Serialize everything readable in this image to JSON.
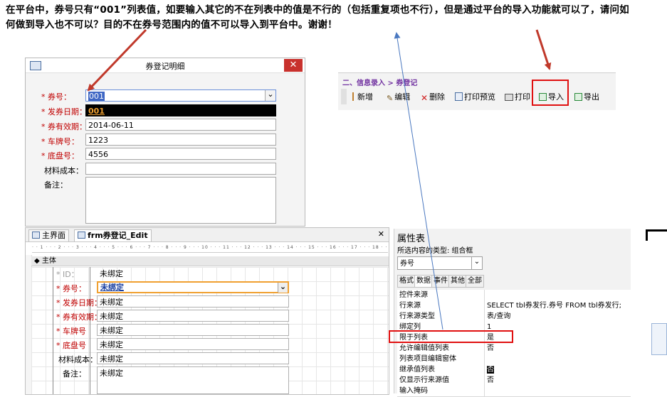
{
  "question": "在平台中，券号只有“001”列表值，如要输入其它的不在列表中的值是不行的（包括重复项也不行），但是通过平台的导入功能就可以了，请问如何做到导入也不可以？目的不在券号范围内的值不可以导入到平台中。谢谢！",
  "dialog": {
    "title": "券登记明细",
    "close": "✕",
    "fields": [
      {
        "label": "* 券号：",
        "value": "001"
      },
      {
        "label": "* 发券日期：",
        "value": "001"
      },
      {
        "label": "* 券有效期：",
        "value": "2014-06-11"
      },
      {
        "label": "* 车牌号：",
        "value": "1223"
      },
      {
        "label": "* 底盘号：",
        "value": "4556"
      },
      {
        "label": "材料成本：",
        "value": ""
      },
      {
        "label": "备注：",
        "value": ""
      }
    ],
    "dropdown_arrow": "⌄"
  },
  "toolbar": {
    "breadcrumb": "二、信息录入 > 券登记",
    "buttons": [
      {
        "label": "新增",
        "icon": "add-icon"
      },
      {
        "label": "编辑",
        "icon": "edit-icon"
      },
      {
        "label": "删除",
        "icon": "delete-icon"
      },
      {
        "label": "打印预览",
        "icon": "print-preview-icon"
      },
      {
        "label": "打印",
        "icon": "print-icon"
      },
      {
        "label": "导入",
        "icon": "import-icon"
      },
      {
        "label": "导出",
        "icon": "export-icon"
      }
    ]
  },
  "access": {
    "tabs": [
      "主界面",
      "frm券登记_Edit"
    ],
    "close_mark": "✕",
    "ruler": "· · 1 · · · 2 · · · 3 · · · 4 · · · 5 · · · 6 · · · 7 · · · 8 · · · 9 · · · 10 · · · 11 · · · 12 · · · 13 · · · 14 · · · 15 · · · 16 · · · 17 · · · 18 · ·",
    "section": "◆ 主体",
    "rows": [
      {
        "label": "* ID：",
        "value": "未绑定"
      },
      {
        "label": "* 券号：",
        "value": "未绑定"
      },
      {
        "label": "* 发券日期：",
        "value": "未绑定"
      },
      {
        "label": "* 券有效期：",
        "value": "未绑定"
      },
      {
        "label": "* 车牌号",
        "value": "未绑定"
      },
      {
        "label": "* 底盘号",
        "value": "未绑定"
      },
      {
        "label": "材料成本：",
        "value": "未绑定"
      },
      {
        "label": "备注：",
        "value": "未绑定"
      }
    ]
  },
  "props": {
    "title": "属性表",
    "type_label": "所选内容的类型: 组合框",
    "combo_value": "券号",
    "tabs": [
      "格式",
      "数据",
      "事件",
      "其他",
      "全部"
    ],
    "rows": [
      {
        "name": "控件来源",
        "value": ""
      },
      {
        "name": "行来源",
        "value": "SELECT tbl券发行.券号 FROM tbl券发行;"
      },
      {
        "name": "行来源类型",
        "value": "表/查询"
      },
      {
        "name": "绑定列",
        "value": "1"
      },
      {
        "name": "限于列表",
        "value": "是"
      },
      {
        "name": "允许编辑值列表",
        "value": "否"
      },
      {
        "name": "列表项目编辑窗体",
        "value": ""
      },
      {
        "name": "继承值列表",
        "value": "否"
      },
      {
        "name": "仅显示行来源值",
        "value": "否"
      },
      {
        "name": "输入掩码",
        "value": ""
      }
    ]
  },
  "colors": {
    "highlight_red": "#e01010",
    "arrow_red": "#c0392b",
    "arrow_blue": "#4a78c0",
    "label_red": "#c00000",
    "combo_orange": "#f0a030"
  }
}
